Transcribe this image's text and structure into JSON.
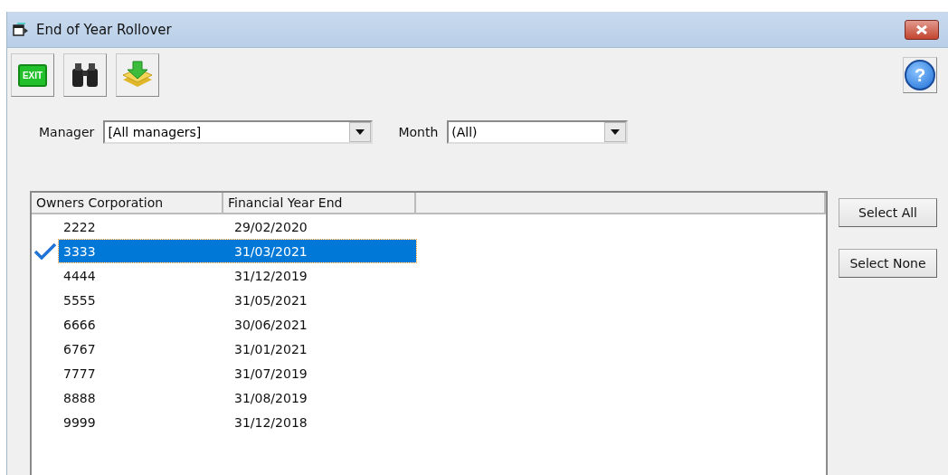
{
  "window": {
    "title": "End of Year Rollover"
  },
  "filters": [
    {
      "label": "Manager",
      "value": "[All managers]"
    },
    {
      "label": "Month",
      "value": "(All)"
    }
  ],
  "table": {
    "columns": [
      "Owners Corporation",
      "Financial Year End"
    ],
    "rows": [
      {
        "cells": [
          "2222",
          "29/02/2020"
        ],
        "checked": false,
        "selected": false
      },
      {
        "cells": [
          "3333",
          "31/03/2021"
        ],
        "checked": true,
        "selected": true
      },
      {
        "cells": [
          "4444",
          "31/12/2019"
        ],
        "checked": false,
        "selected": false
      },
      {
        "cells": [
          "5555",
          "31/05/2021"
        ],
        "checked": false,
        "selected": false
      },
      {
        "cells": [
          "6666",
          "30/06/2021"
        ],
        "checked": false,
        "selected": false
      },
      {
        "cells": [
          "6767",
          "31/01/2021"
        ],
        "checked": false,
        "selected": false
      },
      {
        "cells": [
          "7777",
          "31/07/2019"
        ],
        "checked": false,
        "selected": false
      },
      {
        "cells": [
          "8888",
          "31/08/2019"
        ],
        "checked": false,
        "selected": false
      },
      {
        "cells": [
          "9999",
          "31/12/2018"
        ],
        "checked": false,
        "selected": false
      }
    ]
  },
  "toolbar": {
    "exit_label": "EXIT",
    "help_label": "?"
  },
  "buttons": [
    "Select All",
    "Select None"
  ]
}
